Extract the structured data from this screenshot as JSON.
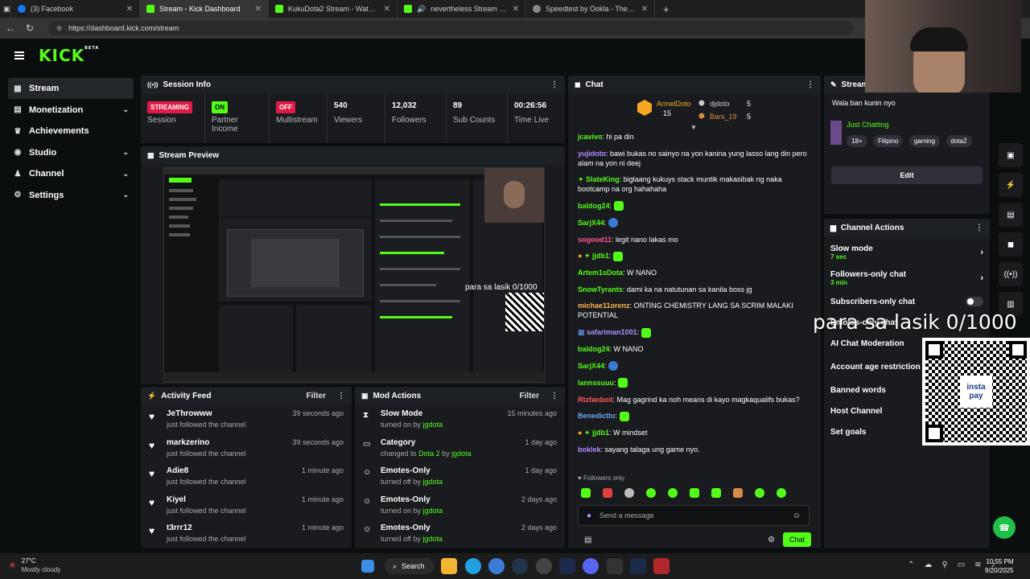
{
  "browser": {
    "tabs": [
      {
        "title": "(3) Facebook",
        "color": "#1877f2"
      },
      {
        "title": "Stream - Kick Dashboard",
        "color": "#53fc18"
      },
      {
        "title": "KukuDota2 Stream - Watch Live o",
        "color": "#53fc18"
      },
      {
        "title": "nevertheless Stream - Watch",
        "color": "#53fc18"
      },
      {
        "title": "Speedtest by Ookla - The Global",
        "color": "#888888"
      }
    ],
    "url": "https://dashboard.kick.com/stream"
  },
  "header": {
    "logo": "KICK",
    "logo_sup": "BETA"
  },
  "sidebar": {
    "items": [
      {
        "label": "Stream",
        "icon": "broadcast-icon"
      },
      {
        "label": "Monetization",
        "icon": "money-icon"
      },
      {
        "label": "Achievements",
        "icon": "trophy-icon"
      },
      {
        "label": "Studio",
        "icon": "studio-icon"
      },
      {
        "label": "Channel",
        "icon": "channel-icon"
      },
      {
        "label": "Settings",
        "icon": "gear-icon"
      }
    ]
  },
  "session": {
    "title": "Session Info",
    "stats": [
      {
        "value": "STREAMING",
        "label": "Session"
      },
      {
        "value": "ON",
        "label": "Partner Income"
      },
      {
        "value": "OFF",
        "label": "Multistream"
      },
      {
        "value": "540",
        "label": "Viewers"
      },
      {
        "value": "12,032",
        "label": "Followers"
      },
      {
        "value": "89",
        "label": "Sub Counts"
      },
      {
        "value": "00:26:56",
        "label": "Time Live"
      }
    ]
  },
  "preview": {
    "title": "Stream Preview",
    "overlay": "para sa lasik 0/1000"
  },
  "activity": {
    "title": "Activity Feed",
    "filter": "Filter",
    "items": [
      {
        "who": "JeThrowww",
        "sub": "just followed the channel",
        "time": "39 seconds ago"
      },
      {
        "who": "markzerino",
        "sub": "just followed the channel",
        "time": "39 seconds ago"
      },
      {
        "who": "Adie8",
        "sub": "just followed the channel",
        "time": "1 minute ago"
      },
      {
        "who": "Kiyel",
        "sub": "just followed the channel",
        "time": "1 minute ago"
      },
      {
        "who": "t3rrr12",
        "sub": "just followed the channel",
        "time": "1 minute ago"
      }
    ]
  },
  "mod": {
    "title": "Mod Actions",
    "filter": "Filter",
    "items": [
      {
        "action": "Slow Mode",
        "pre": "turned on by",
        "target": "",
        "by": "jgdota",
        "time": "15 minutes ago"
      },
      {
        "action": "Category",
        "pre": "changed to",
        "target": "Dota 2",
        "by": "jgdota",
        "time": "1 day ago"
      },
      {
        "action": "Emotes-Only",
        "pre": "turned off by",
        "target": "",
        "by": "jgdota",
        "time": "1 day ago"
      },
      {
        "action": "Emotes-Only",
        "pre": "turned on by",
        "target": "",
        "by": "jgdota",
        "time": "2 days ago"
      },
      {
        "action": "Emotes-Only",
        "pre": "turned off by",
        "target": "",
        "by": "jgdota",
        "time": "2 days ago"
      }
    ]
  },
  "chat": {
    "title": "Chat",
    "leaders": [
      {
        "name": "ArmelDoto",
        "count": "15"
      },
      {
        "name": "djdoto",
        "count": "5"
      },
      {
        "name": "Bars_19",
        "count": "5"
      }
    ],
    "messages": [
      {
        "user": "jcavivo",
        "color": "#53fc18",
        "text": "hi pa din"
      },
      {
        "user": "yujidoto",
        "color": "#b18cff",
        "text": "bawi bukas no sainyo na yon kanina yung lasso lang din pero alam na yon ni deej"
      },
      {
        "user": "SlateKing",
        "color": "#53fc18",
        "text": "biglaang kukuys stack muntik makasibak ng naka bootcamp na org hahahaha"
      },
      {
        "user": "baldog24",
        "color": "#53fc18",
        "text": ""
      },
      {
        "user": "SarjX44",
        "color": "#53fc18",
        "text": ""
      },
      {
        "user": "sogood11",
        "color": "#ff5a8a",
        "text": "legit nano lakas mo"
      },
      {
        "user": "jjdb1",
        "color": "#53fc18",
        "text": ""
      },
      {
        "user": "Artem1sDota",
        "color": "#53fc18",
        "text": "W NANO"
      },
      {
        "user": "SnowTyrants",
        "color": "#53fc18",
        "text": "dami ka na natutunan sa kanila boss jg"
      },
      {
        "user": "michae11orenz",
        "color": "#ffb84d",
        "text": "ONTING CHEMISTRY LANG SA SCRIM MALAKI POTENTIAL"
      },
      {
        "user": "safariman1001",
        "color": "#b18cff",
        "text": ""
      },
      {
        "user": "baldog24",
        "color": "#53fc18",
        "text": "W NANO"
      },
      {
        "user": "SarjX44",
        "color": "#53fc18",
        "text": ""
      },
      {
        "user": "lannssuuu",
        "color": "#53fc18",
        "text": ""
      },
      {
        "user": "Rtzfanboii",
        "color": "#ff5a5a",
        "text": "Mag gagrind ka noh means di kayo magkaqualifs bukas?"
      },
      {
        "user": "Benedictto",
        "color": "#6aa8ff",
        "text": ""
      },
      {
        "user": "jjdb1",
        "color": "#53fc18",
        "text": "W mindset"
      },
      {
        "user": "boklek",
        "color": "#b18cff",
        "text": "sayang talaga ung game nyo."
      }
    ],
    "followers_only": "Followers only",
    "input_placeholder": "Send a message",
    "send": "Chat"
  },
  "stream_info": {
    "title": "Stream",
    "stream_title": "Wala ban kunin nyo",
    "category": "Just Chatting",
    "tags": [
      "18+",
      "Filipino",
      "gaming",
      "dota2"
    ],
    "edit": "Edit"
  },
  "channel_actions": {
    "title": "Channel Actions",
    "items": [
      {
        "label": "Slow mode",
        "sub": "7 sec"
      },
      {
        "label": "Followers-only chat",
        "sub": "3 min"
      },
      {
        "label": "Subscribers-only chat",
        "sub": ""
      },
      {
        "label": "Emotes-only chat",
        "sub": ""
      },
      {
        "label": "AI Chat Moderation",
        "sub": ""
      },
      {
        "label": "Account age restriction",
        "sub": ""
      },
      {
        "label": "Banned words",
        "sub": ""
      },
      {
        "label": "Host Channel",
        "sub": ""
      },
      {
        "label": "Set goals",
        "sub": ""
      }
    ]
  },
  "overlay": {
    "text": "para sa lasik 0/1000",
    "qr_label": "insta pay"
  },
  "taskbar": {
    "weather_temp": "27°C",
    "weather_desc": "Mostly cloudy",
    "search": "Search",
    "time": "10:55 PM",
    "date": "9/20/2025"
  }
}
